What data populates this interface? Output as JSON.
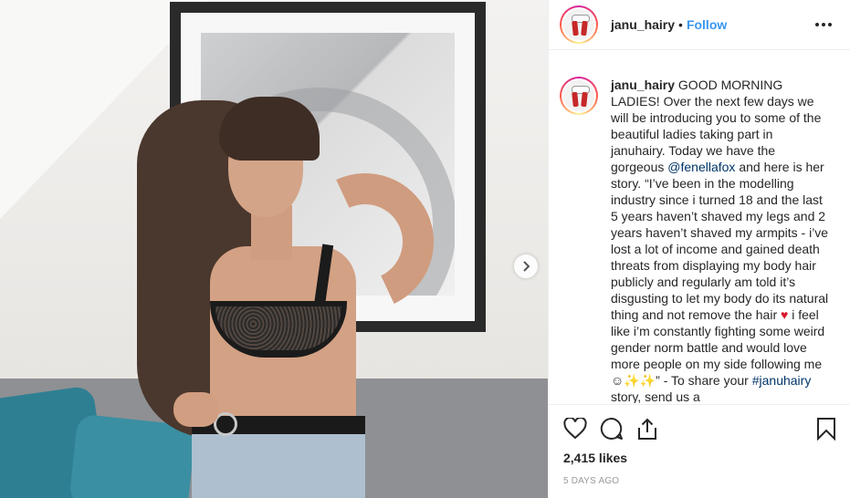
{
  "post": {
    "username": "janu_hairy",
    "separator": "•",
    "follow_label": "Follow",
    "more_icon": "more-options-icon",
    "next_icon": "chevron-right-icon"
  },
  "caption": {
    "username": "janu_hairy",
    "text_1": " GOOD MORNING LADIES! Over the next few days we will be introducing you to some of the beautiful ladies taking part in januhairy. Today we have the gorgeous ",
    "mention": "@fenellafox",
    "text_2": " and here is her story. “I’ve been in the modelling industry since i turned 18 and the last 5 years haven’t shaved my legs and 2 years haven’t shaved my armpits - i’ve lost a lot of income and gained death threats from displaying my body hair publicly and regularly am told it’s disgusting to let my body do its natural thing and not remove the hair ",
    "heart": "♥",
    "text_3": " i feel like i’m constantly fighting some weird gender norm battle and would love more people on my side following me ☺✨✨” - To share your ",
    "hashtag": "#januhairy",
    "text_4": " story, send us a"
  },
  "actions": {
    "like_icon": "heart-icon",
    "comment_icon": "comment-icon",
    "share_icon": "share-icon",
    "save_icon": "bookmark-icon"
  },
  "stats": {
    "likes": "2,415 likes",
    "time_ago": "5 DAYS AGO"
  },
  "colors": {
    "link": "#3897f0",
    "mention": "#003569",
    "text": "#262626",
    "muted": "#999999",
    "border": "#efefef"
  }
}
